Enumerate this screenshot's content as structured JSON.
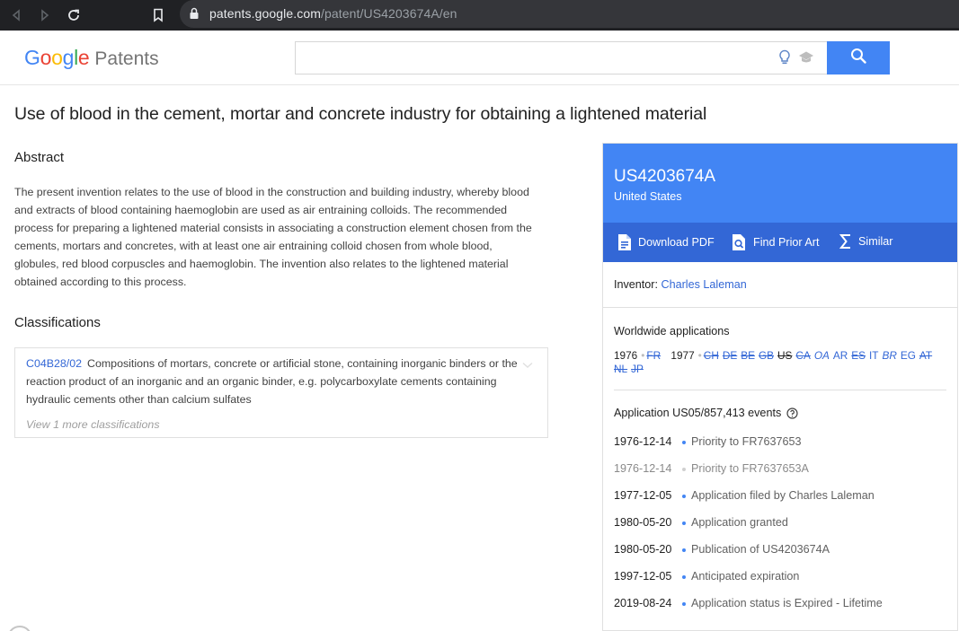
{
  "browser": {
    "url_host": "patents.google.com",
    "url_path": "/patent/US4203674A/en"
  },
  "header": {
    "logo_google": [
      "G",
      "o",
      "o",
      "g",
      "l",
      "e"
    ],
    "logo_product": "Patents",
    "search_placeholder": ""
  },
  "title": "Use of blood in the cement, mortar and concrete industry for obtaining a lightened material",
  "abstract": {
    "heading": "Abstract",
    "text": "The present invention relates to the use of blood in the construction and building industry, whereby blood and extracts of blood containing haemoglobin are used as air entraining colloids. The recommended process for preparing a lightened material consists in associating a construction element chosen from the cements, mortars and concretes, with at least one air entraining colloid chosen from whole blood, globules, red blood corpuscles and haemoglobin. The invention also relates to the lightened material obtained according to this process."
  },
  "classifications": {
    "heading": "Classifications",
    "code": "C04B28/02",
    "description": "Compositions of mortars, concrete or artificial stone, containing inorganic binders or the reaction product of an inorganic and an organic binder, e.g. polycarboxylate cements containing hydraulic cements other than calcium sulfates",
    "more": "View 1 more classifications"
  },
  "patent_card": {
    "number": "US4203674A",
    "country": "United States",
    "actions": {
      "download": "Download PDF",
      "prior_art": "Find Prior Art",
      "similar": "Similar"
    },
    "inventor_label": "Inventor:",
    "inventor_name": "Charles Laleman",
    "worldwide": {
      "heading": "Worldwide applications",
      "year1": "1976",
      "year1_codes": [
        "FR"
      ],
      "year2": "1977",
      "year2_codes": [
        "CH",
        "DE",
        "BE",
        "GB",
        "US",
        "CA",
        "OA",
        "AR",
        "ES",
        "IT",
        "BR",
        "EG",
        "AT",
        "NL",
        "JP"
      ]
    },
    "events_heading": "Application US05/857,413 events",
    "events": [
      {
        "date": "1976-12-14",
        "desc": "Priority to FR7637653"
      },
      {
        "date": "1976-12-14",
        "desc": "Priority to FR7637653A"
      },
      {
        "date": "1977-12-05",
        "desc": "Application filed by Charles Laleman"
      },
      {
        "date": "1980-05-20",
        "desc": "Application granted"
      },
      {
        "date": "1980-05-20",
        "desc": "Publication of US4203674A"
      },
      {
        "date": "1997-12-05",
        "desc": "Anticipated expiration"
      },
      {
        "date": "2019-08-24",
        "desc": "Application status is Expired - Lifetime"
      }
    ]
  },
  "colors": {
    "primary_blue": "#4285f4",
    "dark_blue": "#3367d6",
    "browser_dark": "#202124"
  }
}
